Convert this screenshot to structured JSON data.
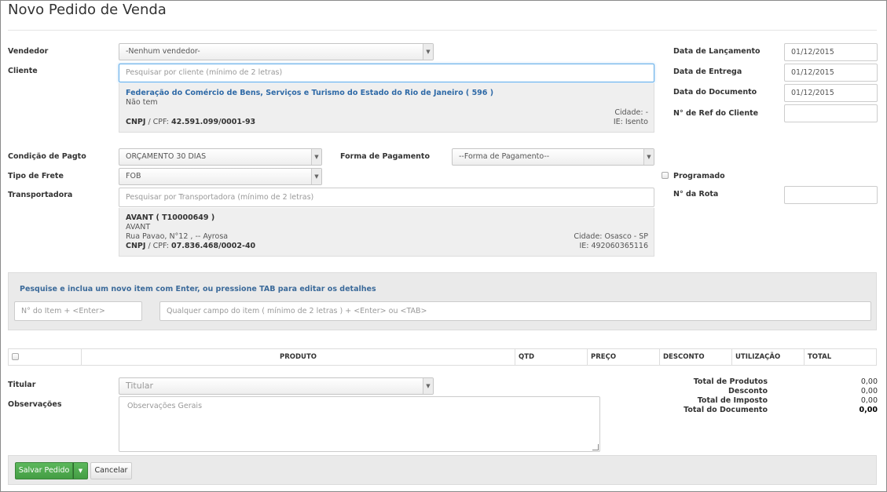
{
  "page": {
    "title": "Novo Pedido de Venda"
  },
  "form": {
    "vendedor": {
      "label": "Vendedor",
      "value": "-Nenhum vendedor-"
    },
    "cliente": {
      "label": "Cliente",
      "placeholder": "Pesquisar por cliente (mínimo de 2 letras)",
      "name": "Federação do Comércio de Bens, Serviços e Turismo do Estado do Rio de Janeiro ( 596 )",
      "subtitle": "Não tem",
      "city": "Cidade: -",
      "ie": "IE: Isento",
      "cnpj_label": "CNPJ",
      "cpf_label": "/ CPF:",
      "cnpj_value": "42.591.099/0001-93"
    },
    "data_lancamento": {
      "label": "Data de Lançamento",
      "value": "01/12/2015"
    },
    "data_entrega": {
      "label": "Data de Entrega",
      "value": "01/12/2015"
    },
    "data_documento": {
      "label": "Data do Documento",
      "value": "01/12/2015"
    },
    "ref_cliente": {
      "label": "N° de Ref do Cliente",
      "value": ""
    },
    "condicao_pagto": {
      "label": "Condição de Pagto",
      "value": "ORÇAMENTO 30 DIAS"
    },
    "forma_pagamento": {
      "label": "Forma de Pagamento",
      "value": "--Forma de Pagamento--"
    },
    "tipo_frete": {
      "label": "Tipo de Frete",
      "value": "FOB"
    },
    "programado": {
      "label": "Programado",
      "checked": false
    },
    "transportadora": {
      "label": "Transportadora",
      "placeholder": "Pesquisar por Transportadora (mínimo de 2 letras)",
      "name": "AVANT ( T10000649 )",
      "subtitle": "AVANT",
      "address": "Rua Pavao, N°12 , -- Ayrosa",
      "city": "Cidade: Osasco - SP",
      "ie": "IE: 492060365116",
      "cnpj_label": "CNPJ",
      "cpf_label": "/ CPF:",
      "cnpj_value": "07.836.468/0002-40"
    },
    "rota": {
      "label": "N° da Rota",
      "value": ""
    }
  },
  "item_search": {
    "title": "Pesquise e inclua um novo item com Enter, ou pressione TAB para editar os detalhes",
    "item_no_placeholder": "N° do Item + <Enter>",
    "any_field_placeholder": "Qualquer campo do item ( mínimo de 2 letras ) + <Enter> ou <TAB>"
  },
  "items_table": {
    "columns": [
      "PRODUTO",
      "QTD",
      "PREÇO",
      "DESCONTO",
      "UTILIZAÇÃO",
      "TOTAL"
    ]
  },
  "bottom": {
    "titular": {
      "label": "Titular",
      "placeholder": "Titular"
    },
    "observacoes": {
      "label": "Observações",
      "placeholder": "Observações Gerais"
    }
  },
  "totals": [
    {
      "label": "Total de Produtos",
      "value": "0,00"
    },
    {
      "label": "Desconto",
      "value": "0,00"
    },
    {
      "label": "Total de Imposto",
      "value": "0,00"
    },
    {
      "label": "Total do Documento",
      "value": "0,00"
    }
  ],
  "actions": {
    "save": "Salvar Pedido",
    "cancel": "Cancelar"
  },
  "colors": {
    "accent_blue": "#2f6aa7",
    "save_green": "#5cb85c",
    "panel_gray": "#eaeaea"
  }
}
